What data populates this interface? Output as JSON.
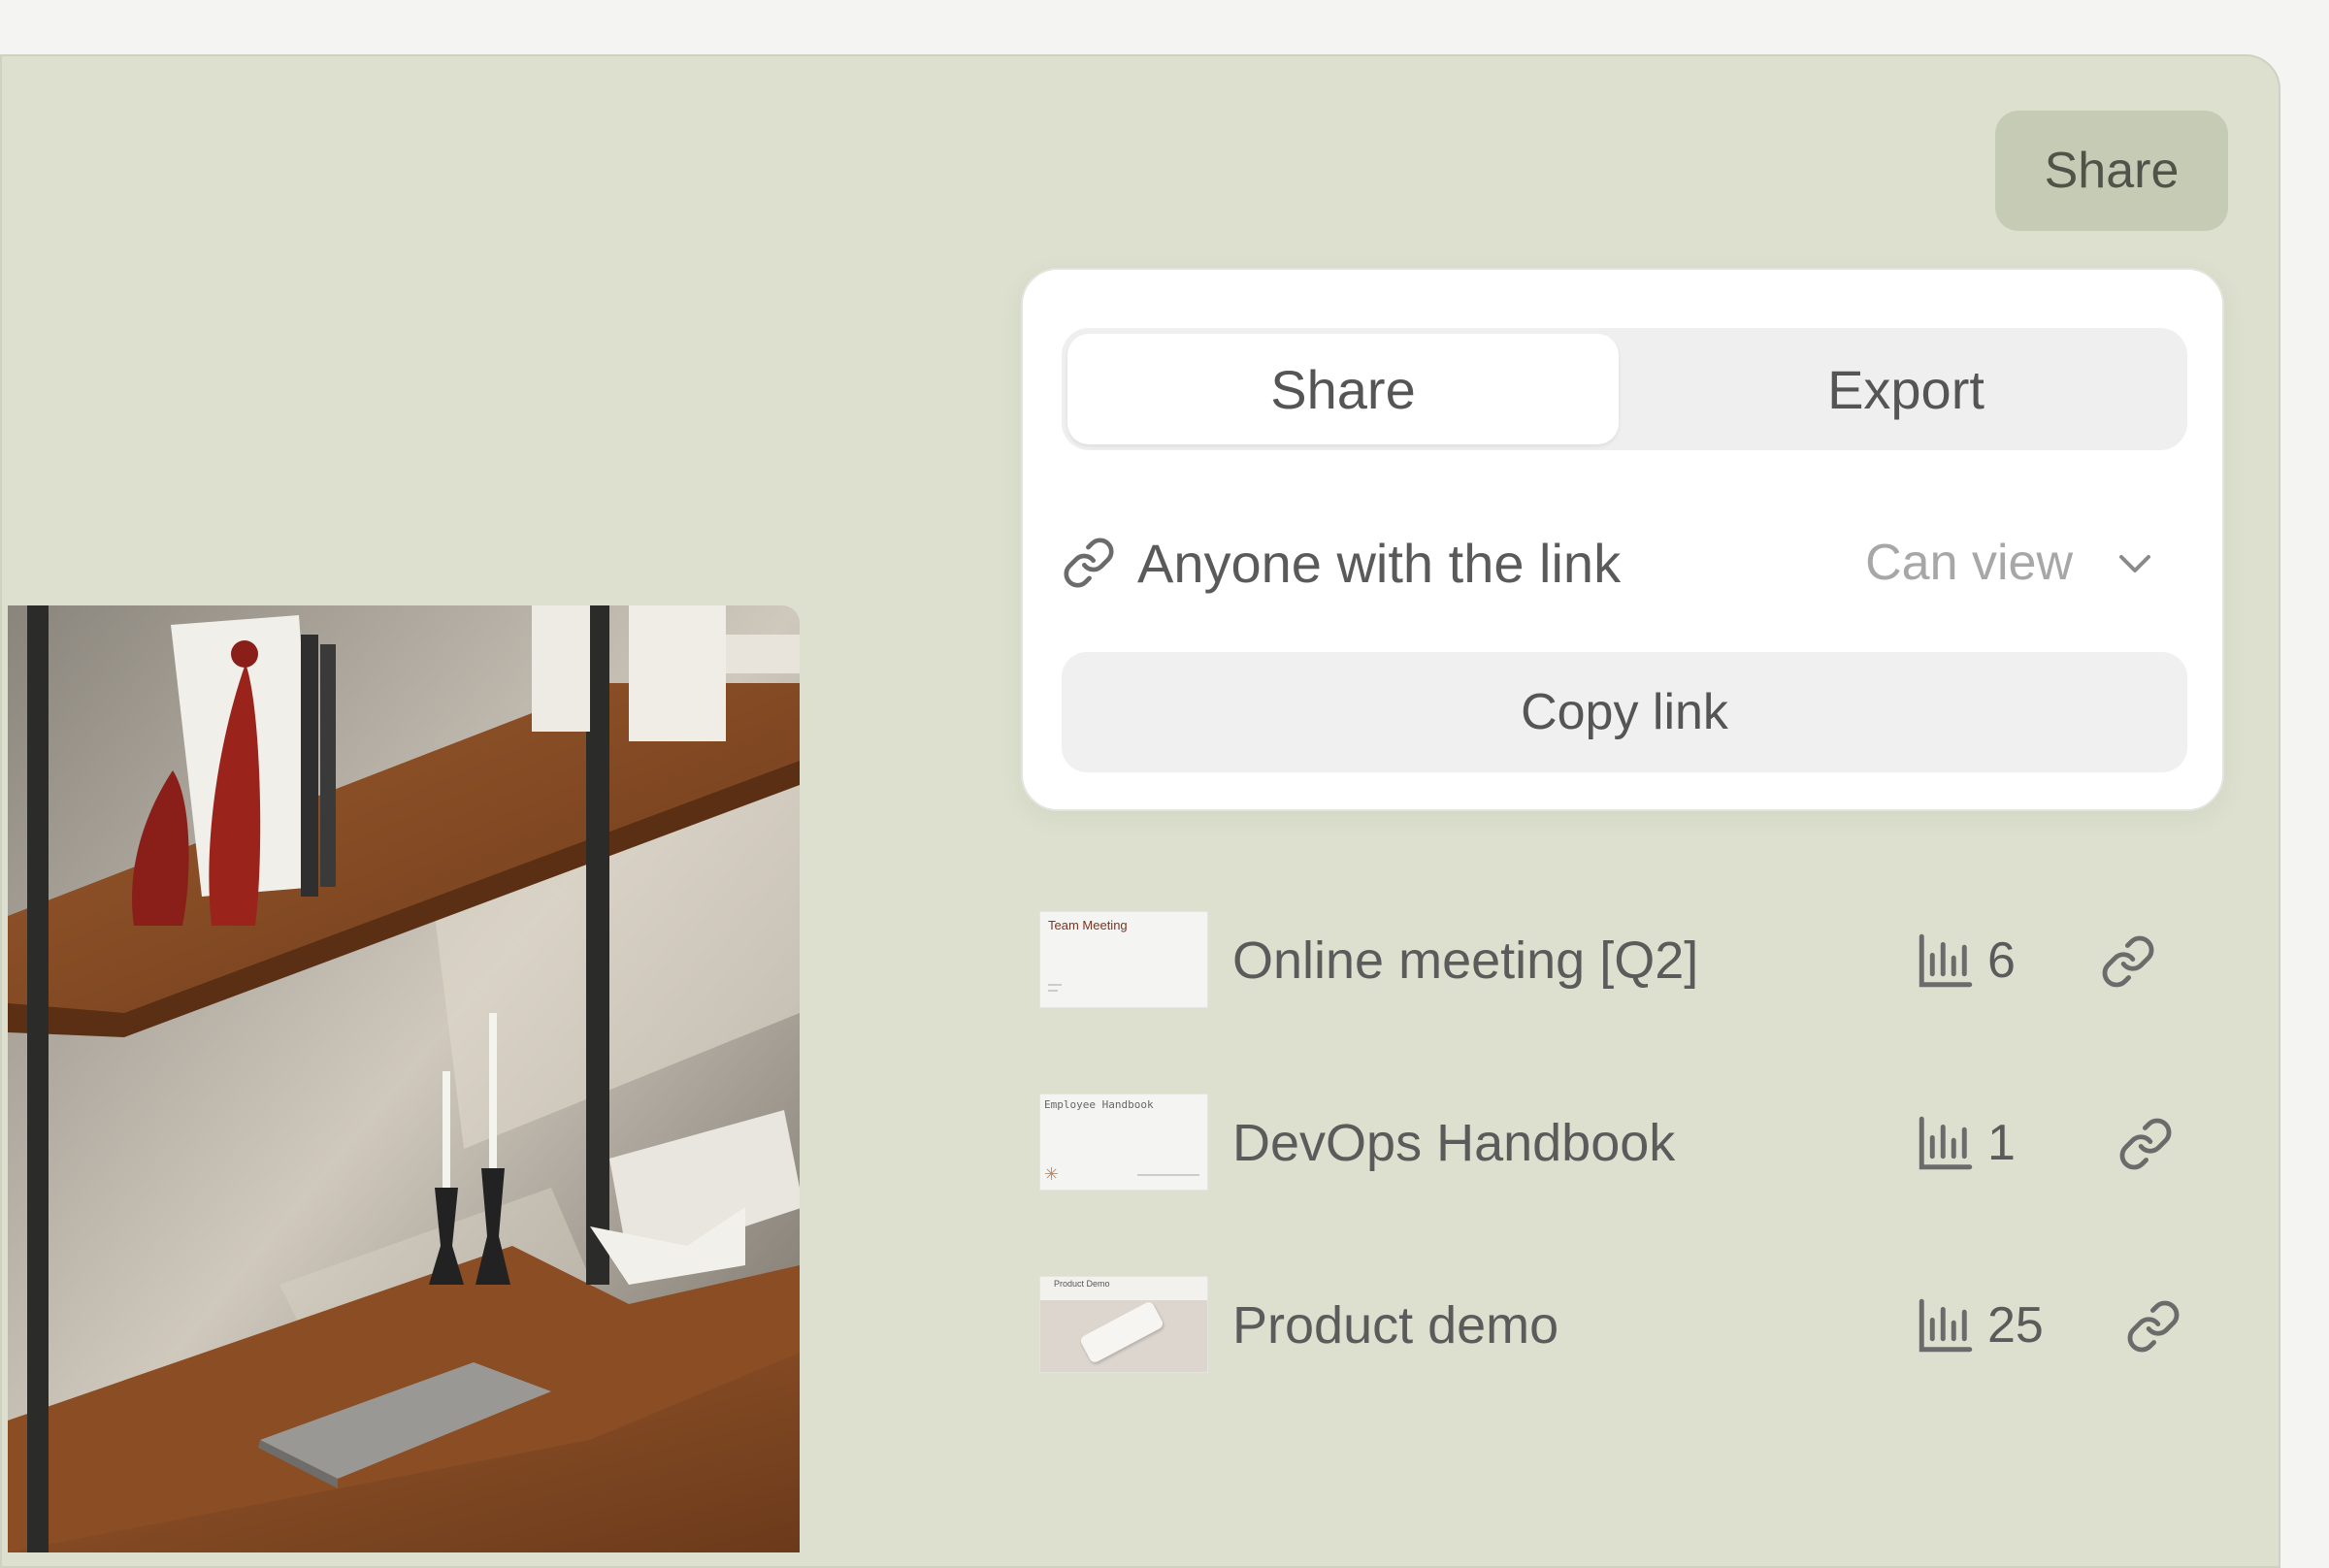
{
  "toolbar": {
    "share_label": "Share"
  },
  "dialog": {
    "tabs": [
      {
        "label": "Share",
        "active": true
      },
      {
        "label": "Export",
        "active": false
      }
    ],
    "link_access": {
      "label": "Anyone with the link",
      "permission": "Can view"
    },
    "copy_label": "Copy link"
  },
  "documents": [
    {
      "thumb_text": "Team Meeting",
      "title": "Online meeting [Q2]",
      "views": "6"
    },
    {
      "thumb_text": "Employee Handbook",
      "title": "DevOps Handbook",
      "views": "1"
    },
    {
      "thumb_text": "Product Demo",
      "title": "Product demo",
      "views": "25"
    }
  ],
  "colors": {
    "background": "#dde0cf",
    "button": "#c6cbb6",
    "card": "#ffffff",
    "text": "#5b5b5b"
  }
}
